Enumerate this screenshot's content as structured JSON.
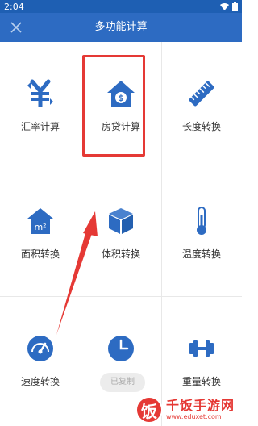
{
  "status_bar": {
    "time": "2:04"
  },
  "app_bar": {
    "title": "多功能计算",
    "close_icon": "close-icon"
  },
  "colors": {
    "primary": "#2d6bc2",
    "highlight": "#e53935"
  },
  "tools": [
    {
      "label": "汇率计算",
      "icon": "yen-exchange-icon"
    },
    {
      "label": "房贷计算",
      "icon": "house-dollar-icon"
    },
    {
      "label": "长度转换",
      "icon": "ruler-icon"
    },
    {
      "label": "面积转换",
      "icon": "area-house-m2-icon"
    },
    {
      "label": "体积转换",
      "icon": "cube-icon"
    },
    {
      "label": "温度转换",
      "icon": "thermometer-icon"
    },
    {
      "label": "速度转换",
      "icon": "speedometer-icon"
    },
    {
      "label": "",
      "icon": "clock-icon"
    },
    {
      "label": "重量转换",
      "icon": "dumbbell-icon"
    }
  ],
  "toast": {
    "text": "已复制"
  },
  "watermark": {
    "logo_char": "饭",
    "title": "千饭手游网",
    "url": "www.eduxet.com"
  }
}
